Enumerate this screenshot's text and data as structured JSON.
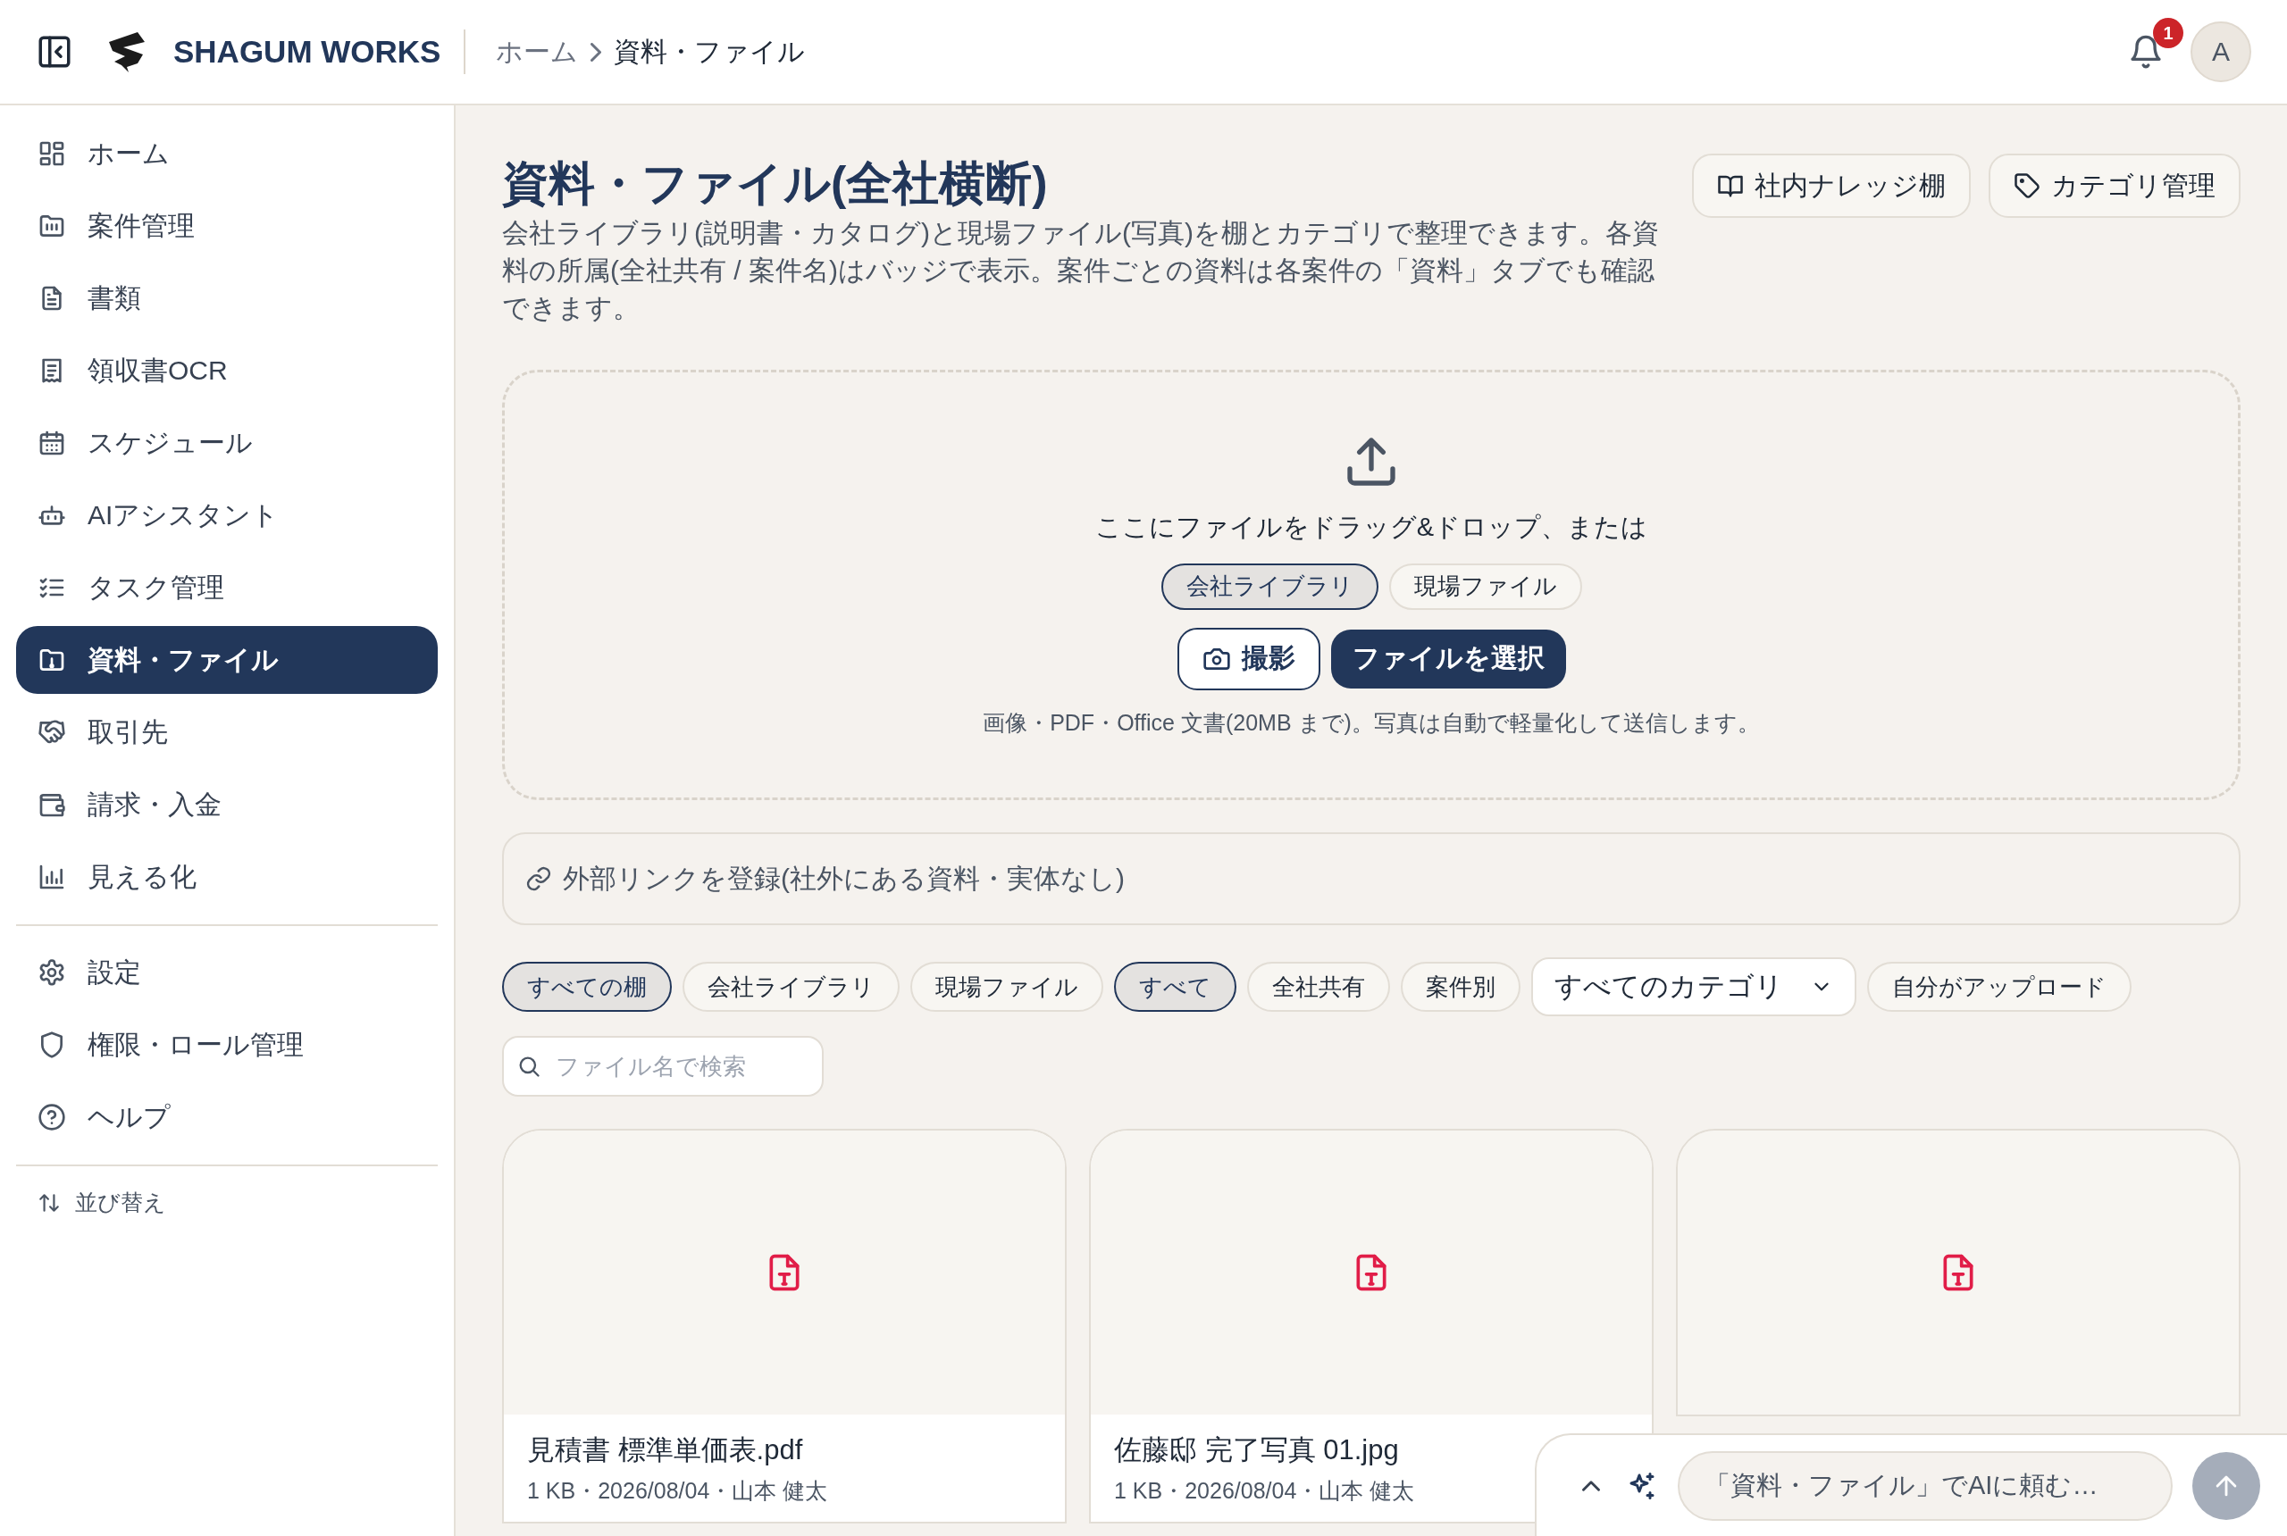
{
  "header": {
    "brand": "SHAGUM WORKS",
    "breadcrumb": [
      "ホーム",
      "資料・ファイル"
    ],
    "notification_count": "1",
    "avatar": "A"
  },
  "sidebar": {
    "items": [
      {
        "label": "ホーム",
        "selected": false
      },
      {
        "label": "案件管理",
        "selected": false
      },
      {
        "label": "書類",
        "selected": false
      },
      {
        "label": "領収書OCR",
        "selected": false
      },
      {
        "label": "スケジュール",
        "selected": false
      },
      {
        "label": "AIアシスタント",
        "selected": false
      },
      {
        "label": "タスク管理",
        "selected": false
      },
      {
        "label": "資料・ファイル",
        "selected": true
      },
      {
        "label": "取引先",
        "selected": false
      },
      {
        "label": "請求・入金",
        "selected": false
      },
      {
        "label": "見える化",
        "selected": false
      }
    ],
    "settings_items": [
      {
        "label": "設定",
        "selected": false
      },
      {
        "label": "権限・ロール管理",
        "selected": false
      },
      {
        "label": "ヘルプ",
        "selected": false
      }
    ],
    "sort_label": "並び替え"
  },
  "page": {
    "title": "資料・ファイル(全社横断)",
    "description": "会社ライブラリ(説明書・カタログ)と現場ファイル(写真)を棚とカテゴリで整理できます。各資料の所属(全社共有 / 案件名)はバッジで表示。案件ごとの資料は各案件の「資料」タブでも確認できます。",
    "actions": [
      "社内ナレッジ棚",
      "カテゴリ管理"
    ]
  },
  "upload": {
    "prompt": "ここにファイルをドラッグ&ドロップ、または",
    "shelves": [
      {
        "label": "会社ライブラリ",
        "selected": true
      },
      {
        "label": "現場ファイル",
        "selected": false
      }
    ],
    "camera_button": "撮影",
    "select_button": "ファイルを選択",
    "note": "画像・PDF・Office 文書(20MB まで)。写真は自動で軽量化して送信します。"
  },
  "external_link": {
    "label": "外部リンクを登録(社外にある資料・実体なし)"
  },
  "filters": {
    "shelves": [
      {
        "label": "すべての棚",
        "selected": true
      },
      {
        "label": "会社ライブラリ",
        "selected": false
      },
      {
        "label": "現場ファイル",
        "selected": false
      }
    ],
    "scopes": [
      {
        "label": "すべて",
        "selected": true
      },
      {
        "label": "全社共有",
        "selected": false
      },
      {
        "label": "案件別",
        "selected": false
      }
    ],
    "category": "すべてのカテゴリ",
    "mine": {
      "label": "自分がアップロード",
      "selected": false
    },
    "search": {
      "placeholder": "ファイル名で検索"
    }
  },
  "files": [
    {
      "kind": "file",
      "name": "見積書 標準単価表.pdf",
      "meta": "1 KB・2026/08/04・山本 健太"
    },
    {
      "kind": "file",
      "name": "佐藤邸 完了写真 01.jpg",
      "meta": "1 KB・2026/08/04・山本 健太"
    },
    {
      "kind": "file"
    }
  ],
  "ai_bar": {
    "placeholder": "「資料・ファイル」でAIに頼む…"
  }
}
